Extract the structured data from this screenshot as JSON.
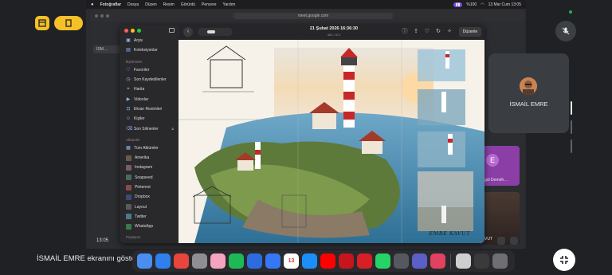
{
  "menubar": {
    "app": "Fotoğraflar",
    "menus": [
      "Dosya",
      "Düzen",
      "Resim",
      "Görüntü",
      "Pencere",
      "Yardım"
    ],
    "status_time": "13 Mar Cum 13:05",
    "status_pct": "%100"
  },
  "browser": {
    "address": "meet.google.com"
  },
  "photos": {
    "title": "21 Şubat 2026 16:36:30",
    "subtitle": "461 / 471",
    "edit_label": "Düzenle",
    "sidebar": {
      "top": [
        {
          "label": "Arşiv",
          "icon": "archive-icon"
        },
        {
          "label": "Koleksiyonlar",
          "icon": "collections-icon"
        }
      ],
      "section_utilities": "İliştirmeler",
      "utilities": [
        {
          "label": "Favoriler",
          "icon": "heart-icon"
        },
        {
          "label": "Son Kaydedilenler",
          "icon": "recent-icon"
        },
        {
          "label": "Harita",
          "icon": "map-icon"
        },
        {
          "label": "Videolar",
          "icon": "video-icon"
        },
        {
          "label": "Ekran Resimleri",
          "icon": "screenshot-icon"
        },
        {
          "label": "Kişiler",
          "icon": "people-icon"
        },
        {
          "label": "Son Silinenler",
          "icon": "trash-icon"
        }
      ],
      "section_albums": "Albümler",
      "albums": [
        {
          "label": "Tüm Albümler",
          "icon": "albums-icon"
        },
        {
          "label": "Amerika",
          "icon": "album-thumb-icon"
        },
        {
          "label": "Instagram",
          "icon": "album-thumb-icon"
        },
        {
          "label": "Snapseed",
          "icon": "album-thumb-icon"
        },
        {
          "label": "Pinterest",
          "icon": "album-thumb-icon"
        },
        {
          "label": "Dropbox",
          "icon": "album-thumb-icon"
        },
        {
          "label": "Layout",
          "icon": "album-thumb-icon"
        },
        {
          "label": "Twitter",
          "icon": "album-thumb-icon"
        },
        {
          "label": "WhatsApp",
          "icon": "album-thumb-icon"
        }
      ],
      "section_shared": "Paylaşım"
    },
    "signature": "EMRE KAVUT"
  },
  "shared_meet": {
    "time": "13:05",
    "tile_e_initial": "E",
    "tile_e_name": "gül Demirh…",
    "tile_room_name": "VUT"
  },
  "self_tile": {
    "name": "İSMAİL EMRE"
  },
  "presenting": {
    "text": "İSMAİL EMRE ekranını gösteriyor"
  },
  "dock": [
    {
      "name": "finder",
      "color": "#4a8ef0",
      "glyph": ""
    },
    {
      "name": "safari",
      "color": "#2f80ed",
      "glyph": ""
    },
    {
      "name": "chrome",
      "color": "#e8453c",
      "glyph": ""
    },
    {
      "name": "system-settings",
      "color": "#8e8e93",
      "glyph": ""
    },
    {
      "name": "photos",
      "color": "#f4a3c0",
      "glyph": ""
    },
    {
      "name": "spotify",
      "color": "#1db954",
      "glyph": ""
    },
    {
      "name": "mail-alt",
      "color": "#2d6cdf",
      "glyph": ""
    },
    {
      "name": "mail",
      "color": "#3478f6",
      "glyph": ""
    },
    {
      "name": "calendar",
      "color": "#ffffff",
      "glyph": "13"
    },
    {
      "name": "app-store",
      "color": "#1c8ef9",
      "glyph": ""
    },
    {
      "name": "youtube",
      "color": "#ff0000",
      "glyph": ""
    },
    {
      "name": "acrobat",
      "color": "#c4161c",
      "glyph": ""
    },
    {
      "name": "acrobat-2",
      "color": "#d81f26",
      "glyph": ""
    },
    {
      "name": "whatsapp",
      "color": "#25d366",
      "glyph": ""
    },
    {
      "name": "keynote",
      "color": "#56585f",
      "glyph": ""
    },
    {
      "name": "teams",
      "color": "#5b5fc7",
      "glyph": ""
    },
    {
      "name": "scrobbles",
      "color": "#e0425f",
      "glyph": ""
    },
    {
      "name": "window-1",
      "color": "#cfcfcf",
      "glyph": ""
    },
    {
      "name": "window-2",
      "color": "#3a3a3a",
      "glyph": ""
    },
    {
      "name": "trash",
      "color": "#6e6e73",
      "glyph": ""
    }
  ]
}
